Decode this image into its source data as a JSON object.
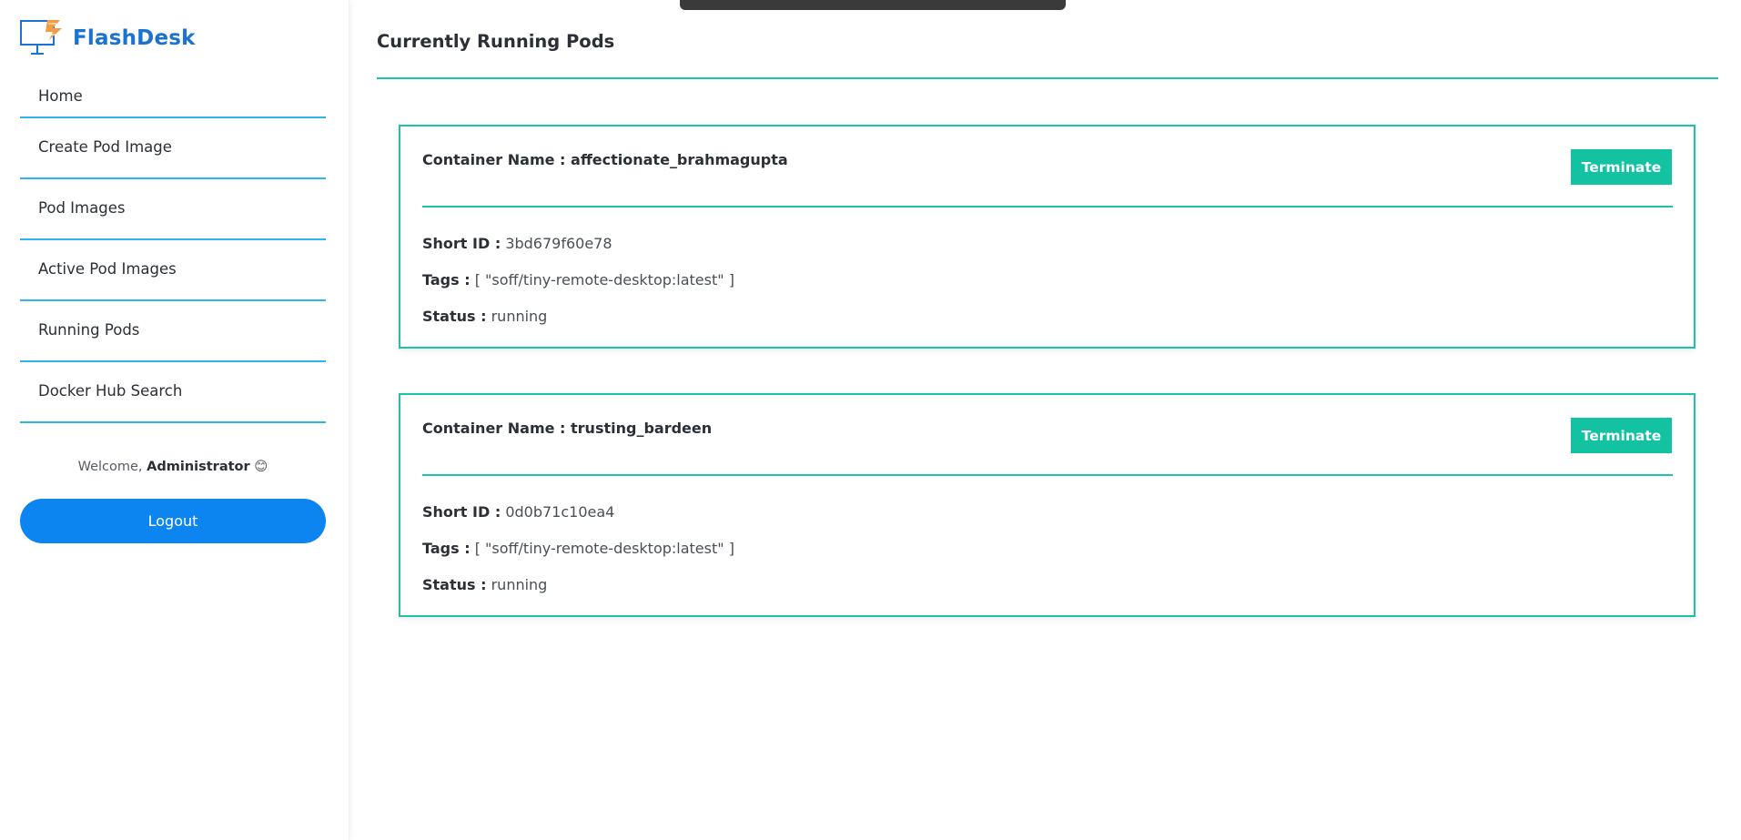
{
  "brand": {
    "name": "FlashDesk",
    "logo_icon": "monitor-flash-icon",
    "color": "#1a73d0"
  },
  "sidebar": {
    "items": [
      {
        "label": "Home"
      },
      {
        "label": "Create Pod Image"
      },
      {
        "label": "Pod Images"
      },
      {
        "label": "Active Pod Images"
      },
      {
        "label": "Running Pods"
      },
      {
        "label": "Docker Hub Search"
      }
    ],
    "welcome_prefix": "Welcome,",
    "welcome_user": "Administrator",
    "welcome_emoji": "😊",
    "logout_label": "Logout"
  },
  "main": {
    "title": "Currently Running Pods",
    "pods": [
      {
        "name_label": "Container Name :",
        "name": "affectionate_brahmagupta",
        "terminate_label": "Terminate",
        "short_id_label": "Short ID :",
        "short_id": "3bd679f60e78",
        "tags_label": "Tags :",
        "tags": "[ \"soff/tiny-remote-desktop:latest\" ]",
        "status_label": "Status :",
        "status": "running"
      },
      {
        "name_label": "Container Name :",
        "name": "trusting_bardeen",
        "terminate_label": "Terminate",
        "short_id_label": "Short ID :",
        "short_id": "0d0b71c10ea4",
        "tags_label": "Tags :",
        "tags": "[ \"soff/tiny-remote-desktop:latest\" ]",
        "status_label": "Status :",
        "status": "running"
      }
    ]
  },
  "colors": {
    "accent": "#1cc4a6",
    "nav_divider": "#2fb5e8",
    "logout": "#0d85f0",
    "terminate": "#12c2a0"
  }
}
